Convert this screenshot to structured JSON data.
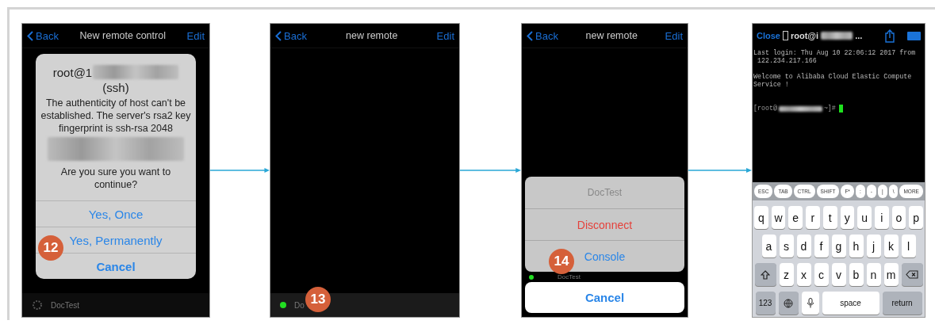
{
  "screens": [
    {
      "kind": "dialog",
      "nav": {
        "back": "Back",
        "title": "New remote control",
        "edit": "Edit"
      },
      "dialog": {
        "host_prefix": "root@1",
        "protocol": "(ssh)",
        "message": "The authenticity of host can't be established. The server's rsa2 key fingerprint is ssh-rsa 2048",
        "question": "Are you sure you want to continue?",
        "buttons": [
          "Yes, Once",
          "Yes, Permanently",
          "Cancel"
        ]
      },
      "footer": "DocTest",
      "step": "12"
    },
    {
      "kind": "list",
      "nav": {
        "back": "Back",
        "title": "new remote",
        "edit": "Edit"
      },
      "item": {
        "label": "Do",
        "color": "#22dd22"
      },
      "step": "13"
    },
    {
      "kind": "sheet",
      "nav": {
        "back": "Back",
        "title": "new remote",
        "edit": "Edit"
      },
      "sheet": {
        "title": "DocTest",
        "destructive": "Disconnect",
        "action": "Console",
        "cancel": "Cancel"
      },
      "item": {
        "label": "DocTest",
        "color": "#22dd22"
      },
      "step": "14"
    },
    {
      "kind": "terminal",
      "header": {
        "close": "Close",
        "title_prefix": "root@i",
        "title_suffix": "..."
      },
      "paragraphs": [
        [
          "Last login: Thu Aug 10 22:06:12 2017 from",
          " 122.234.217.166"
        ],
        [
          "Welcome to Alibaba Cloud Elastic Compute",
          "Service !"
        ]
      ],
      "prompt": {
        "prefix": "[root@",
        "suffix": "~]#"
      },
      "toolbar_keys": [
        "ESC",
        "TAB",
        "CTRL",
        "SHIFT",
        "F*",
        ":",
        "-",
        "|",
        "\\",
        "MORE"
      ],
      "rows": [
        [
          "q",
          "w",
          "e",
          "r",
          "t",
          "y",
          "u",
          "i",
          "o",
          "p"
        ],
        [
          "a",
          "s",
          "d",
          "f",
          "g",
          "h",
          "j",
          "k",
          "l"
        ],
        [
          "z",
          "x",
          "c",
          "v",
          "b",
          "n",
          "m"
        ]
      ],
      "bottom": {
        "numbers": "123",
        "space": "space",
        "return": "return"
      }
    }
  ]
}
